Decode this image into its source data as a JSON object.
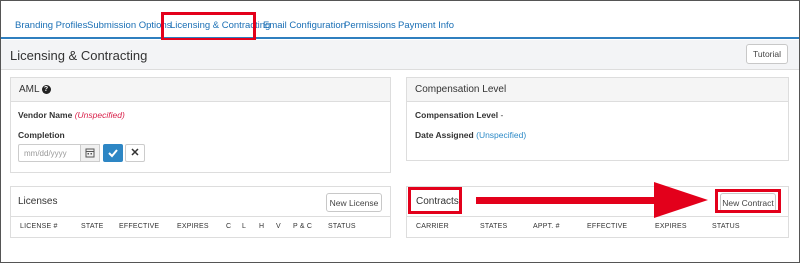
{
  "tabs": [
    {
      "label": "Branding Profiles"
    },
    {
      "label": "Submission Options"
    },
    {
      "label": "Licensing & Contracting"
    },
    {
      "label": "Email Configuration"
    },
    {
      "label": "Permissions"
    },
    {
      "label": "Payment Info"
    }
  ],
  "header": {
    "title": "Licensing & Contracting",
    "tutorial_label": "Tutorial"
  },
  "aml": {
    "title": "AML",
    "vendor_name_label": "Vendor Name",
    "vendor_name_value": "(Unspecified)",
    "completion_label": "Completion",
    "date_placeholder": "mm/dd/yyyy",
    "clear_label": "✕"
  },
  "compensation": {
    "title": "Compensation Level",
    "level_label": "Compensation Level",
    "level_value": "-",
    "date_label": "Date Assigned",
    "date_value": "(Unspecified)"
  },
  "licenses": {
    "title": "Licenses",
    "new_label": "New License",
    "columns": [
      "LICENSE #",
      "STATE",
      "EFFECTIVE",
      "EXPIRES",
      "C",
      "L",
      "H",
      "V",
      "P & C",
      "STATUS"
    ]
  },
  "contracts": {
    "title": "Contracts",
    "new_label": "New Contract",
    "columns": [
      "CARRIER",
      "STATES",
      "APPT. #",
      "EFFECTIVE",
      "EXPIRES",
      "STATUS"
    ]
  },
  "colors": {
    "accent": "#2f7fbf",
    "annotation": "#e3001b",
    "unspecified_red": "#d9224b",
    "unspecified_blue": "#2d8ac7"
  }
}
